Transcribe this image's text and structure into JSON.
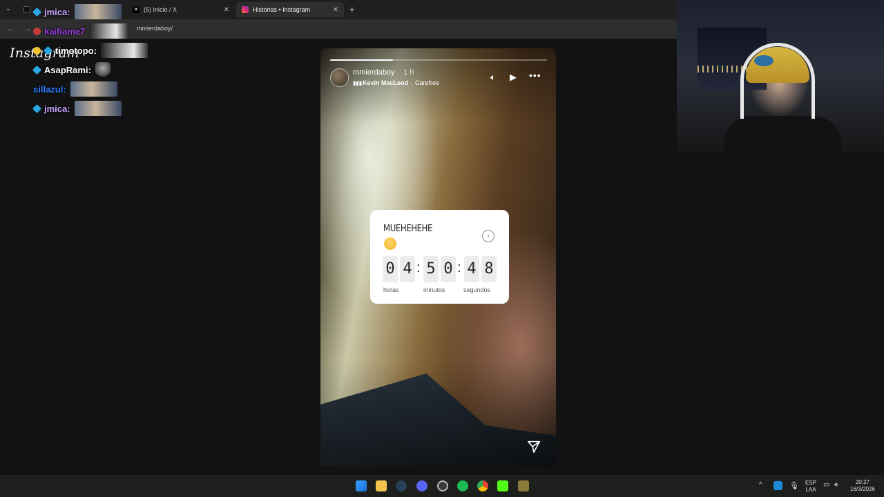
{
  "browser": {
    "tabs": [
      {
        "label": "jmica:"
      },
      {
        "label": "(5) Inicio / X"
      },
      {
        "label": "Historias • Instagram"
      }
    ],
    "url_visible": "mmierdaboy/",
    "brand_overlay_text": "Instagram"
  },
  "chat": [
    {
      "user": "jmica",
      "text": "jmica:",
      "color": "#c9a6ff"
    },
    {
      "user": "kaifiame7",
      "text": "kaifiame7",
      "color": "#9b3fe0"
    },
    {
      "user": "timotopo",
      "text": "timotopo:",
      "color": "#ffffff"
    },
    {
      "user": "AsapRami",
      "text": "AsapRami:",
      "color": "#ffffff"
    },
    {
      "user": "sillazul",
      "text": "sillazul:",
      "color": "#2f7fff"
    },
    {
      "user": "jmica",
      "text": "jmica:",
      "color": "#c9a6ff"
    }
  ],
  "story": {
    "username": "mmierdaboy",
    "time_ago": "1 h",
    "music_artist": "Kevin MacLeod",
    "music_separator": "·",
    "music_song": "Carefree",
    "progress_fraction": 0.29,
    "countdown": {
      "title": "MUEHEHEHE",
      "digits": [
        "0",
        "4",
        "5",
        "0",
        "4",
        "8"
      ],
      "labels": {
        "hours": "horas",
        "minutes": "minutos",
        "seconds": "segundos"
      }
    }
  },
  "taskbar": {
    "lang_top": "ESP",
    "lang_bottom": "LAA",
    "time": "20:27",
    "date": "16/3/2026"
  },
  "colors": {
    "accent_ig": "#e1306c",
    "chat_badge": "#2aa7e2"
  }
}
